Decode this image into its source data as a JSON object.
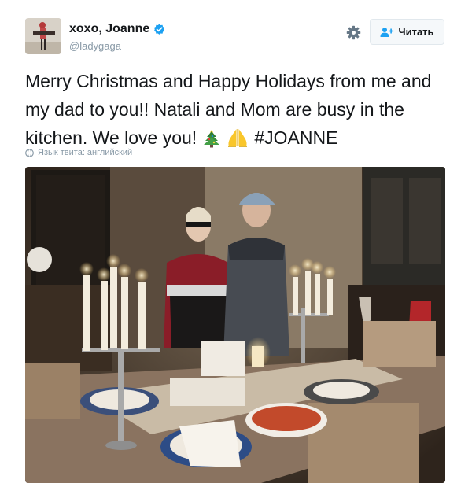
{
  "tweet": {
    "display_name": "xoxo, Joanne",
    "handle": "@ladygaga",
    "follow_label": "Читать",
    "text_parts": {
      "p1": "Merry Christmas and Happy Holidays from me and my dad to you!! Natali and Mom are busy in the kitchen. We love you! ",
      "p2": "#JOANNE"
    },
    "emojis": [
      "christmas-tree-icon",
      "folded-hands-icon"
    ],
    "translate_label": "Язык твита: английский",
    "photo_label": "holiday dinner table photo"
  },
  "icons": [
    "verified-icon",
    "gear-icon",
    "follow-person-icon",
    "globe-icon"
  ],
  "colors": {
    "verified": "#1da1f2",
    "muted_text": "#8899a6",
    "text": "#14171a",
    "follow_bg": "#f5f8fa",
    "follow_border": "#e1e8ed"
  }
}
